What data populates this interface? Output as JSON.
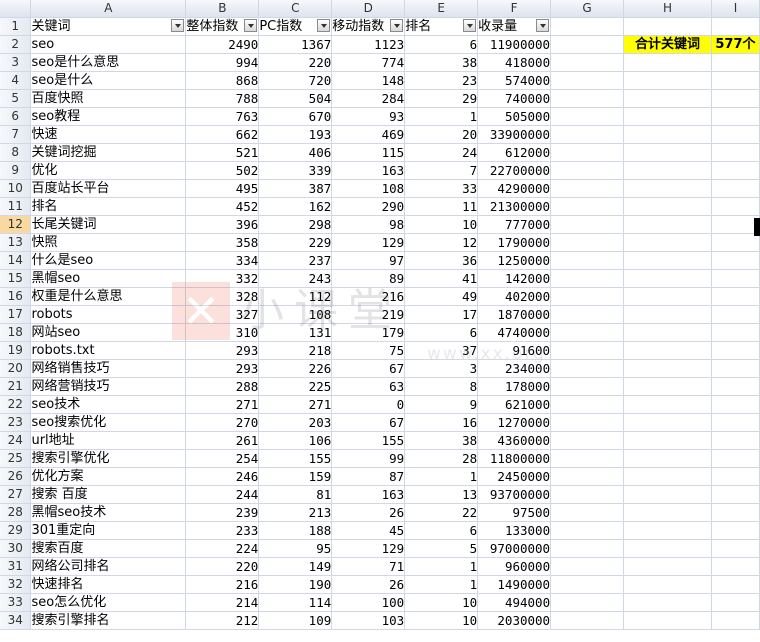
{
  "columns": [
    "A",
    "B",
    "C",
    "D",
    "E",
    "F",
    "G",
    "H",
    "I"
  ],
  "headers": [
    "关键词",
    "整体指数",
    "PC指数",
    "移动指数",
    "排名",
    "收录量"
  ],
  "summary": {
    "label": "合计关键词",
    "value": "577个"
  },
  "rows": [
    [
      "seo",
      "2490",
      "1367",
      "1123",
      "6",
      "11900000"
    ],
    [
      "seo是什么意思",
      "994",
      "220",
      "774",
      "38",
      "418000"
    ],
    [
      "seo是什么",
      "868",
      "720",
      "148",
      "23",
      "574000"
    ],
    [
      "百度快照",
      "788",
      "504",
      "284",
      "29",
      "740000"
    ],
    [
      "seo教程",
      "763",
      "670",
      "93",
      "1",
      "505000"
    ],
    [
      "快速",
      "662",
      "193",
      "469",
      "20",
      "33900000"
    ],
    [
      "关键词挖掘",
      "521",
      "406",
      "115",
      "24",
      "612000"
    ],
    [
      "优化",
      "502",
      "339",
      "163",
      "7",
      "22700000"
    ],
    [
      "百度站长平台",
      "495",
      "387",
      "108",
      "33",
      "4290000"
    ],
    [
      "排名",
      "452",
      "162",
      "290",
      "11",
      "21300000"
    ],
    [
      "长尾关键词",
      "396",
      "298",
      "98",
      "10",
      "777000"
    ],
    [
      "快照",
      "358",
      "229",
      "129",
      "12",
      "1790000"
    ],
    [
      "什么是seo",
      "334",
      "237",
      "97",
      "36",
      "1250000"
    ],
    [
      "黑帽seo",
      "332",
      "243",
      "89",
      "41",
      "142000"
    ],
    [
      "权重是什么意思",
      "328",
      "112",
      "216",
      "49",
      "402000"
    ],
    [
      "robots",
      "327",
      "108",
      "219",
      "17",
      "1870000"
    ],
    [
      "网站seo",
      "310",
      "131",
      "179",
      "6",
      "4740000"
    ],
    [
      "robots.txt",
      "293",
      "218",
      "75",
      "37",
      "91600"
    ],
    [
      "网络销售技巧",
      "293",
      "226",
      "67",
      "3",
      "234000"
    ],
    [
      "网络营销技巧",
      "288",
      "225",
      "63",
      "8",
      "178000"
    ],
    [
      "seo技术",
      "271",
      "271",
      "0",
      "9",
      "621000"
    ],
    [
      "seo搜索优化",
      "270",
      "203",
      "67",
      "16",
      "1270000"
    ],
    [
      "url地址",
      "261",
      "106",
      "155",
      "38",
      "4360000"
    ],
    [
      "搜索引擎优化",
      "254",
      "155",
      "99",
      "28",
      "11800000"
    ],
    [
      "优化方案",
      "246",
      "159",
      "87",
      "1",
      "2450000"
    ],
    [
      "搜索 百度",
      "244",
      "81",
      "163",
      "13",
      "93700000"
    ],
    [
      "黑帽seo技术",
      "239",
      "213",
      "26",
      "22",
      "97500"
    ],
    [
      "301重定向",
      "233",
      "188",
      "45",
      "6",
      "133000"
    ],
    [
      "搜索百度",
      "224",
      "95",
      "129",
      "5",
      "97000000"
    ],
    [
      "网络公司排名",
      "220",
      "149",
      "71",
      "1",
      "960000"
    ],
    [
      "快速排名",
      "216",
      "190",
      "26",
      "1",
      "1490000"
    ],
    [
      "seo怎么优化",
      "214",
      "114",
      "100",
      "10",
      "494000"
    ],
    [
      "搜索引擎排名",
      "212",
      "109",
      "103",
      "10",
      "2030000"
    ]
  ],
  "selected_row": 12,
  "watermark": {
    "text": "小课堂",
    "url": "www.xx.org"
  }
}
